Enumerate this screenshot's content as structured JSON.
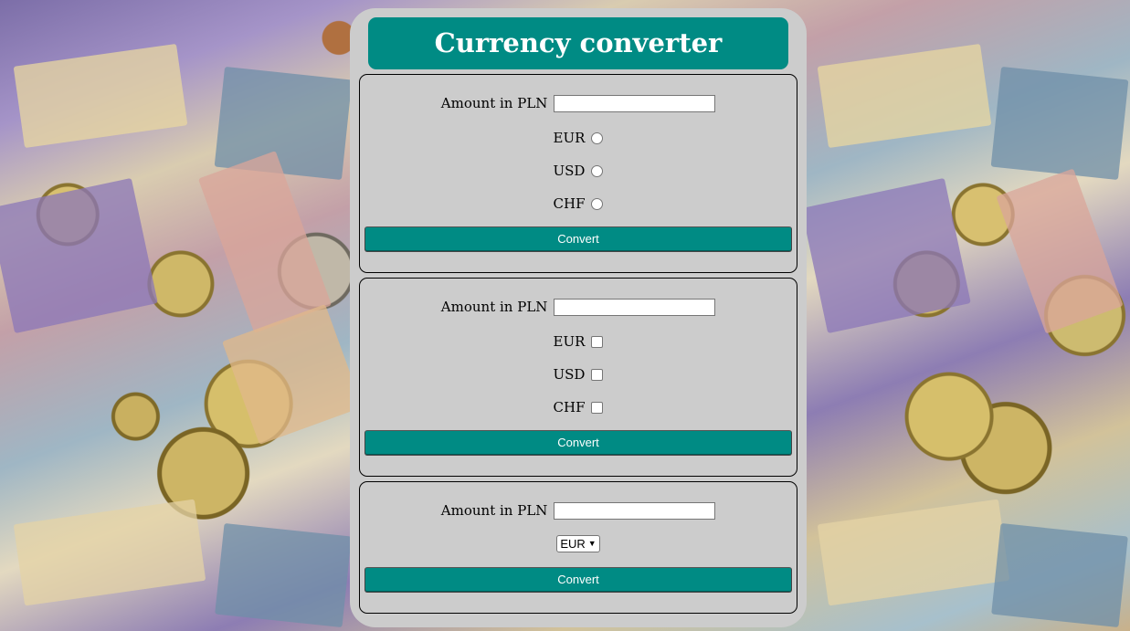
{
  "header": {
    "title": "Currency converter"
  },
  "form_radio": {
    "amount_label": "Amount in PLN",
    "amount_value": "",
    "options": [
      "EUR",
      "USD",
      "CHF"
    ],
    "convert_label": "Convert"
  },
  "form_checkbox": {
    "amount_label": "Amount in PLN",
    "amount_value": "",
    "options": [
      "EUR",
      "USD",
      "CHF"
    ],
    "convert_label": "Convert"
  },
  "form_select": {
    "amount_label": "Amount in PLN",
    "amount_value": "",
    "selected_currency": "EUR",
    "convert_label": "Convert"
  },
  "colors": {
    "accent": "#008b84",
    "panel": "#cccccc"
  }
}
